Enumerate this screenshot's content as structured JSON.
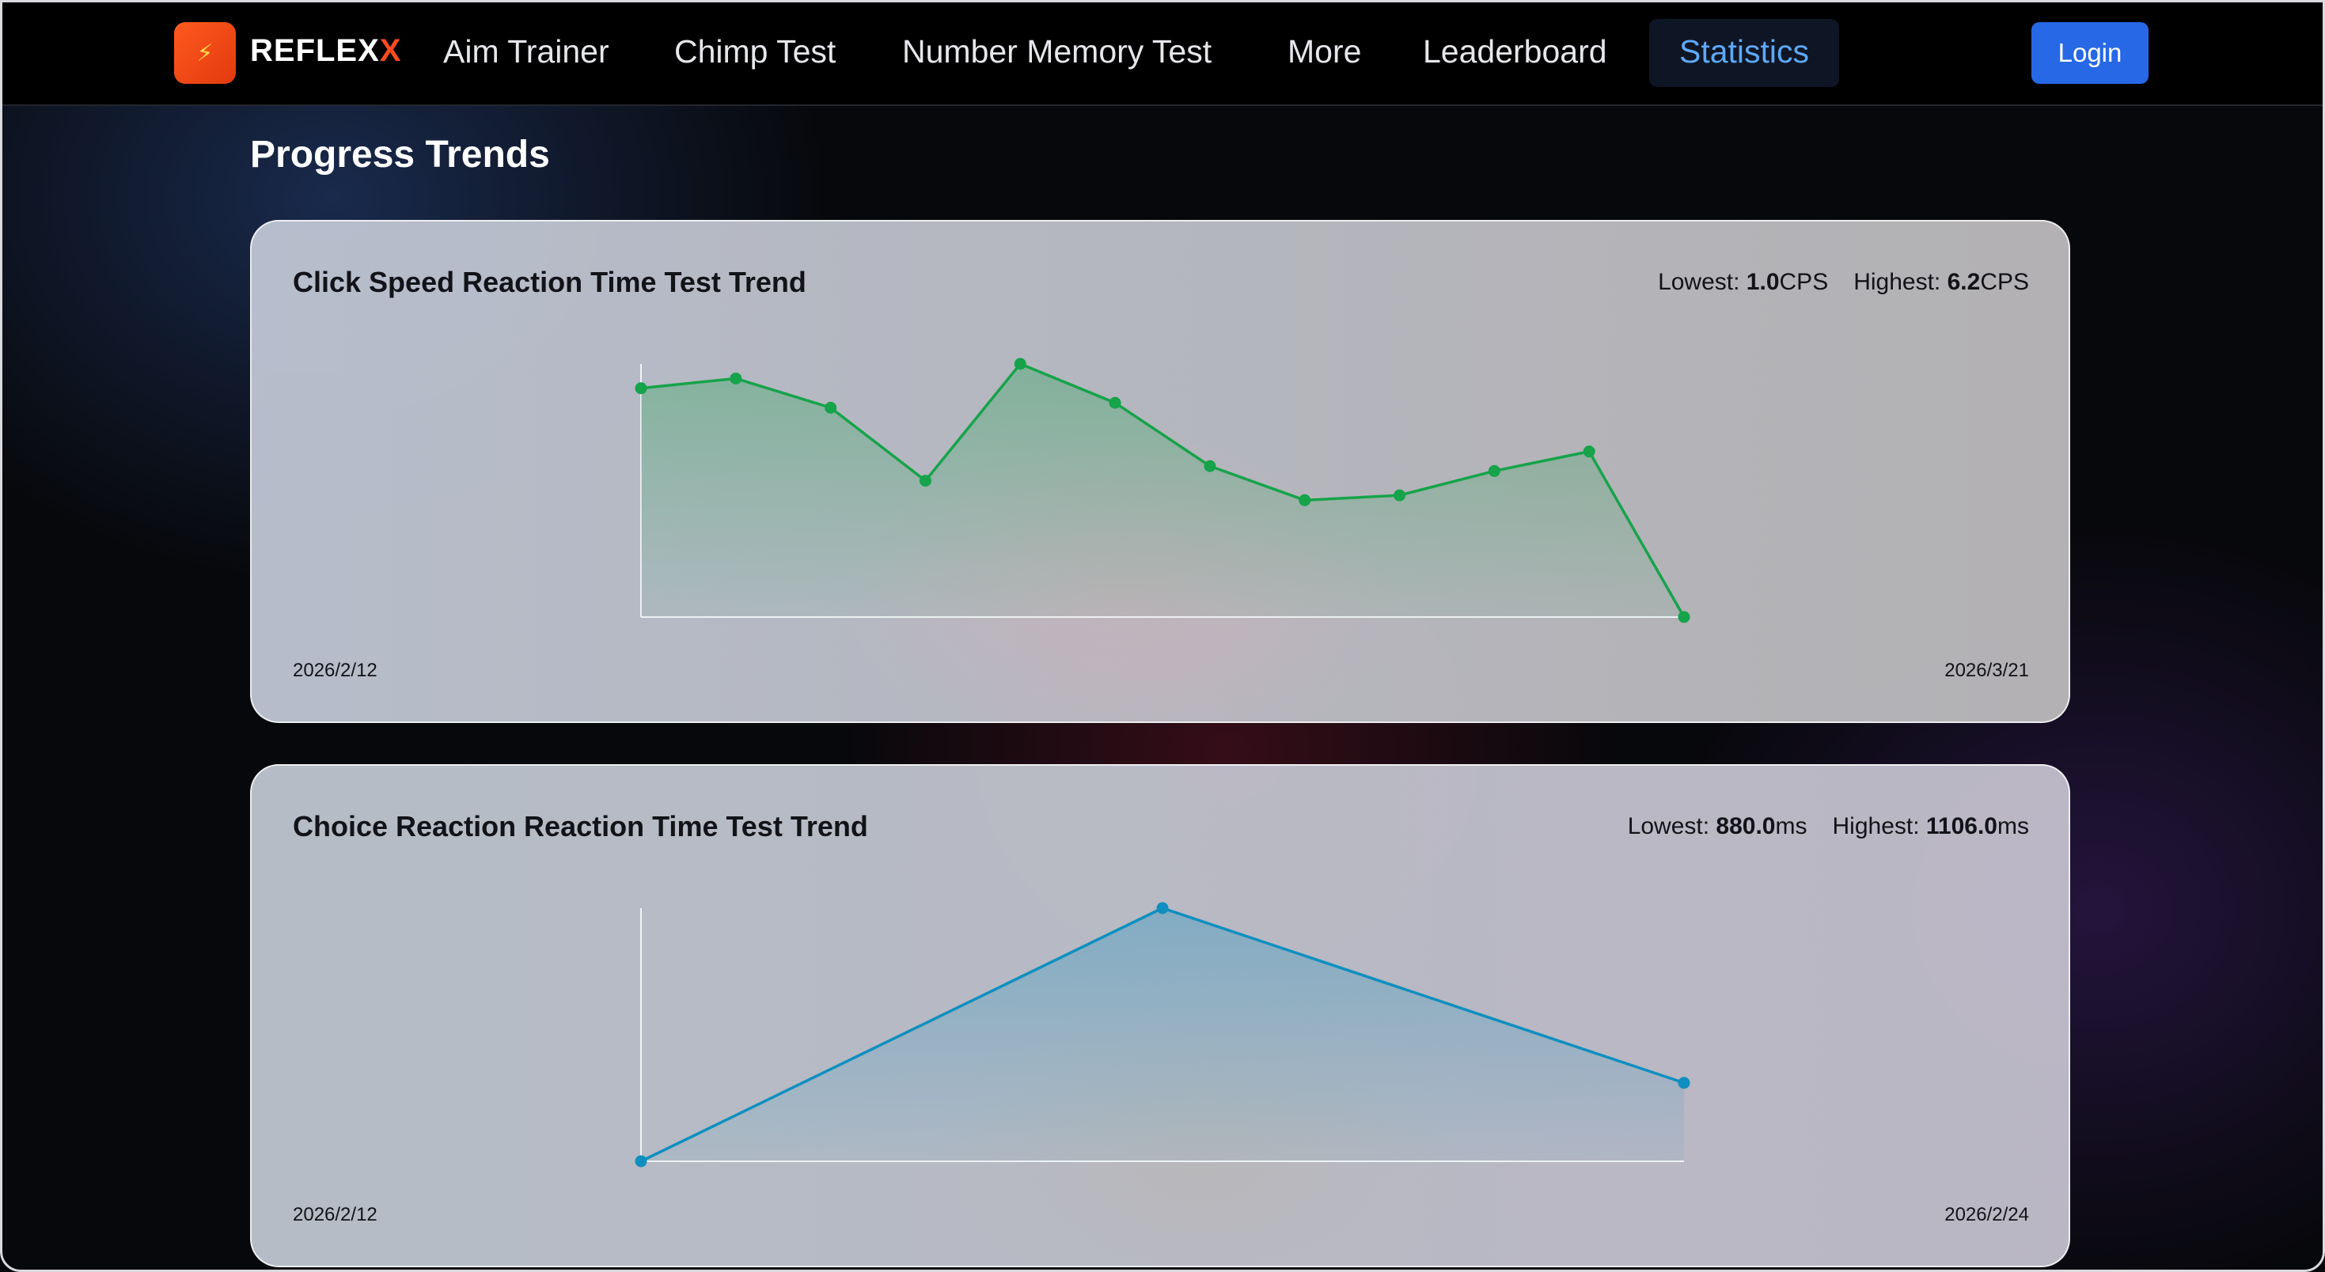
{
  "nav": {
    "brand_main": "REFLEX",
    "brand_x": "X",
    "logo_glyph": "⚡",
    "items": [
      "Aim Trainer",
      "Chimp Test",
      "Number Memory Test",
      "More",
      "Leaderboard"
    ],
    "active": "Statistics",
    "login": "Login"
  },
  "page_title": "Progress Trends",
  "colors": {
    "accent_blue": "#2668e6",
    "active_text": "#5ea8f7",
    "line_green": "#16a34a",
    "line_blue": "#0e8fbf"
  },
  "cards": [
    {
      "title": "Click Speed Reaction Time Test Trend",
      "lowest_label": "Lowest: ",
      "lowest_value": "1.0",
      "highest_label": "Highest: ",
      "highest_value": "6.2",
      "unit": "CPS",
      "start_date": "2026/2/12",
      "end_date": "2026/3/21"
    },
    {
      "title": "Choice Reaction Reaction Time Test Trend",
      "lowest_label": "Lowest: ",
      "lowest_value": "880.0",
      "highest_label": "Highest: ",
      "highest_value": "1106.0",
      "unit": "ms",
      "start_date": "2026/2/12",
      "end_date": "2026/2/24"
    }
  ],
  "chart_data": [
    {
      "type": "area",
      "title": "Click Speed Reaction Time Test Trend",
      "y_unit": "CPS",
      "ylim": [
        1.0,
        6.2
      ],
      "values": [
        5.7,
        5.9,
        5.3,
        3.8,
        6.2,
        5.4,
        4.1,
        3.4,
        3.5,
        4.0,
        4.4,
        1.0
      ],
      "color": "#16a34a"
    },
    {
      "type": "area",
      "title": "Choice Reaction Reaction Time Test Trend",
      "y_unit": "ms",
      "ylim": [
        880.0,
        1106.0
      ],
      "values": [
        880.0,
        1106.0,
        950.0
      ],
      "color": "#0e8fbf"
    }
  ]
}
